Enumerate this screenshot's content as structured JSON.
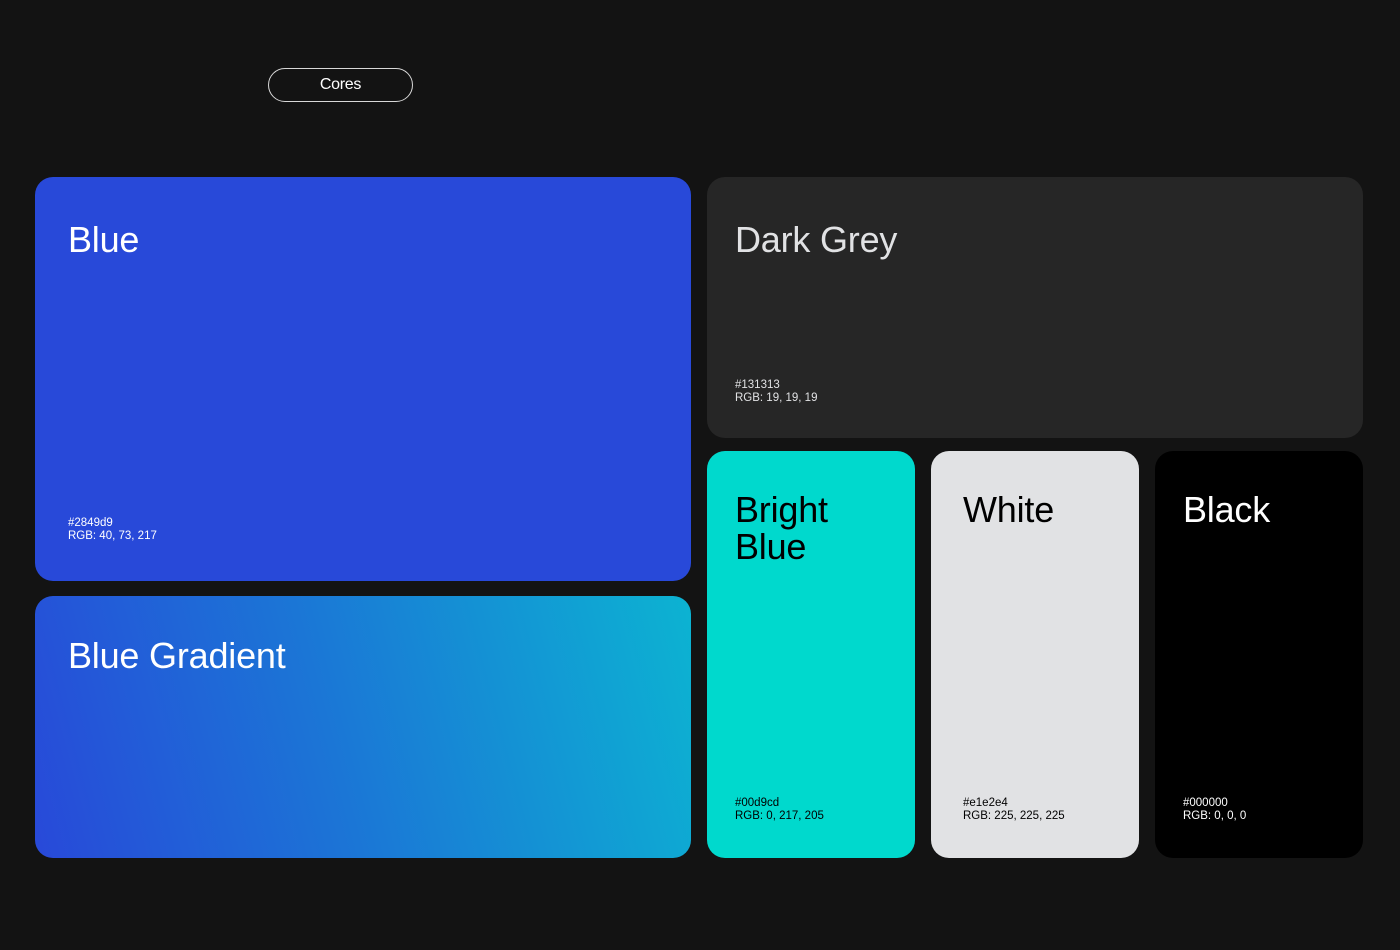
{
  "header": {
    "tag_label": "Cores"
  },
  "swatches": {
    "blue": {
      "name": "Blue",
      "hex": "#2849d9",
      "rgb": "RGB: 40, 73, 217",
      "color": "#2849d9"
    },
    "blue_gradient": {
      "name": "Blue Gradient",
      "color_start": "#2849d9",
      "color_end": "#0cb3d2"
    },
    "dark_grey": {
      "name": "Dark Grey",
      "hex": "#131313",
      "rgb": "RGB: 19, 19, 19",
      "color": "#262626"
    },
    "bright_blue": {
      "name": "Bright Blue",
      "hex": "#00d9cd",
      "rgb": "RGB: 0, 217, 205",
      "color": "#00d9cd"
    },
    "white": {
      "name": "White",
      "hex": "#e1e2e4",
      "rgb": "RGB: 225, 225, 225",
      "color": "#e1e2e4"
    },
    "black": {
      "name": "Black",
      "hex": "#000000",
      "rgb": "RGB: 0, 0, 0",
      "color": "#000000"
    }
  }
}
